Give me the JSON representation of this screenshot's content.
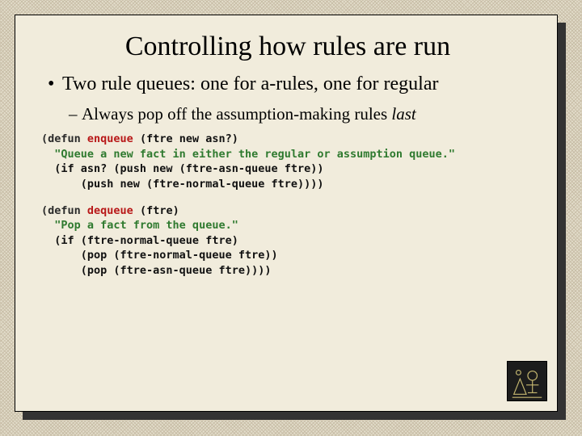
{
  "title": "Controlling how rules are run",
  "bullet": {
    "text": "Two rule queues: one for a-rules, one for regular",
    "sub_pre": "Always pop off the assumption-making rules ",
    "sub_em": "last"
  },
  "code1": {
    "l1a": "(defun ",
    "l1fn": "enqueue",
    "l1b": " (ftre new asn?)",
    "l2": "  \"Queue a new fact in either the regular or assumption queue.\"",
    "l3": "  (if asn? (push new (ftre-asn-queue ftre))",
    "l4": "      (push new (ftre-normal-queue ftre))))"
  },
  "code2": {
    "l1a": "(defun ",
    "l1fn": "dequeue",
    "l1b": " (ftre)",
    "l2": "  \"Pop a fact from the queue.\"",
    "l3": "  (if (ftre-normal-queue ftre)",
    "l4": "      (pop (ftre-normal-queue ftre))",
    "l5": "      (pop (ftre-asn-queue ftre))))"
  }
}
